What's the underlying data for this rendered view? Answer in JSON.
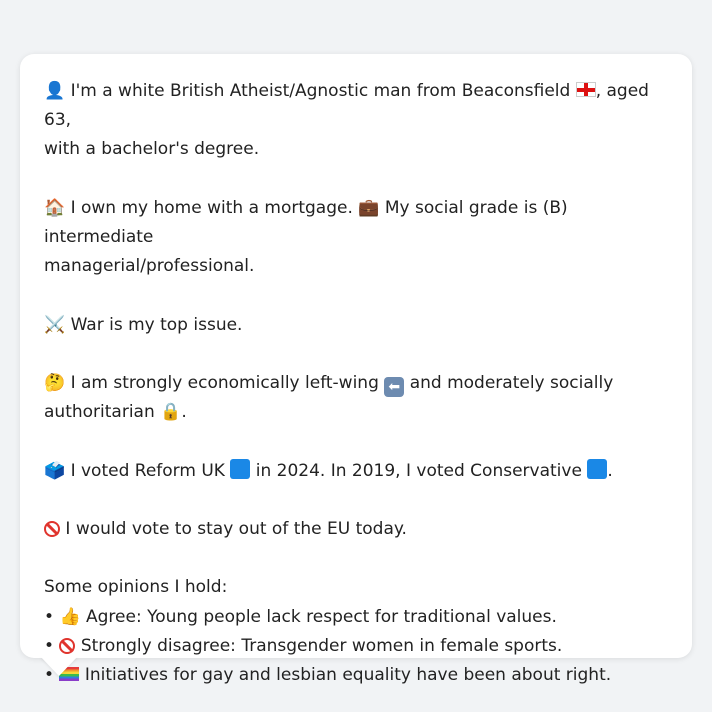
{
  "icons": {
    "person": "👤",
    "house": "🏠",
    "briefcase": "💼",
    "swords": "⚔️",
    "thinking": "🤔",
    "lock": "🔒",
    "ballot": "🗳️",
    "thumbs_up": "👍",
    "no_entry": "no-entry-icon",
    "england_flag": "england-flag-icon",
    "blue_square": "blue-square-icon",
    "left_arrow": "⬅",
    "rainbow_flag": "rainbow-flag-icon"
  },
  "colors": {
    "background": "#f1f3f5",
    "card": "#ffffff",
    "text": "#222222",
    "blue_square": "#1a88e6",
    "no_entry_red": "#e0342d"
  },
  "profile": {
    "identity_a": "I'm a white British Atheist/Agnostic man from Beaconsfield",
    "identity_b": ", aged 63,",
    "identity_c": "with a bachelor's degree.",
    "home_a": "I own my home with a mortgage.",
    "home_b": "My social grade is (B) intermediate",
    "home_c": "managerial/professional.",
    "issue": "War is my top issue.",
    "econ_a": "I am strongly economically left-wing",
    "econ_b": "and moderately socially",
    "econ_c": "authoritarian",
    "econ_d": ".",
    "vote_a": "I voted Reform UK",
    "vote_b": "in 2024. In 2019, I voted Conservative",
    "vote_c": ".",
    "eu": "I would vote to stay out of the EU today.",
    "opinions_heading": "Some opinions I hold:",
    "bullet": "•",
    "opinion_1": "Agree: Young people lack respect for traditional values.",
    "opinion_2": "Strongly disagree: Transgender women in female sports.",
    "opinion_3": "Initiatives for gay and lesbian equality have been about right."
  }
}
